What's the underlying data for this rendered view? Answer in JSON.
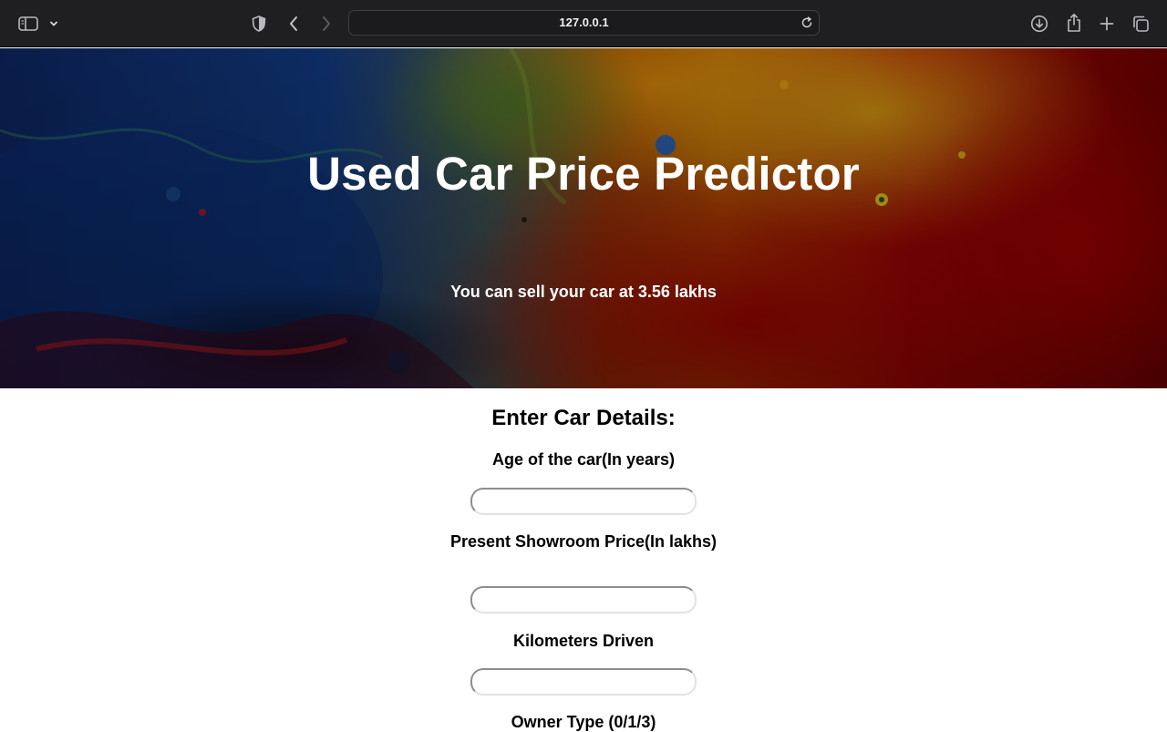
{
  "browser": {
    "url": "127.0.0.1",
    "icons": {
      "sidebar": "sidebar-icon",
      "chevron": "chevron-down-icon",
      "shield": "privacy-shield-icon",
      "back": "back-arrow-icon",
      "forward": "forward-arrow-icon",
      "reload": "reload-icon",
      "download": "download-icon",
      "share": "share-icon",
      "new_tab": "plus-icon",
      "tabs": "tab-overview-icon"
    }
  },
  "hero": {
    "title": "Used Car Price Predictor",
    "result": "You can sell your car at 3.56 lakhs"
  },
  "form": {
    "heading": "Enter Car Details:",
    "fields": [
      {
        "label": "Age of the car(In years)",
        "value": ""
      },
      {
        "label": "Present Showroom Price(In lakhs)",
        "value": ""
      },
      {
        "label": "Kilometers Driven",
        "value": ""
      },
      {
        "label": "Owner Type (0/1/3)",
        "value": ""
      }
    ]
  },
  "colors": {
    "toolbar": "#1f1f22",
    "hero_red": "#8a0000",
    "hero_blue": "#0b2a5e",
    "text": "#000000"
  }
}
